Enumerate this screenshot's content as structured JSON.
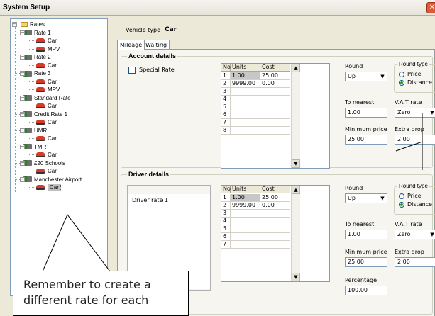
{
  "window": {
    "title": "System Setup",
    "close_glyph": "✕"
  },
  "tree": {
    "root": "Rates",
    "nodes": [
      {
        "label": "Rate 1",
        "kind": "rate"
      },
      {
        "label": "Car",
        "kind": "car"
      },
      {
        "label": "MPV",
        "kind": "car"
      },
      {
        "label": "Rate 2",
        "kind": "rate"
      },
      {
        "label": "Car",
        "kind": "car"
      },
      {
        "label": "Rate 3",
        "kind": "rate"
      },
      {
        "label": "Car",
        "kind": "car"
      },
      {
        "label": "MPV",
        "kind": "car"
      },
      {
        "label": "Standard Rate",
        "kind": "rate"
      },
      {
        "label": "Car",
        "kind": "car"
      },
      {
        "label": "Credit Rate 1",
        "kind": "rate"
      },
      {
        "label": "Car",
        "kind": "car"
      },
      {
        "label": "UMR",
        "kind": "rate"
      },
      {
        "label": "Car",
        "kind": "car"
      },
      {
        "label": "TMR",
        "kind": "rate"
      },
      {
        "label": "Car",
        "kind": "car"
      },
      {
        "label": "£20 Schools",
        "kind": "rate"
      },
      {
        "label": "Car",
        "kind": "car"
      },
      {
        "label": "Manchester Airport",
        "kind": "rate"
      },
      {
        "label": "Car",
        "kind": "car",
        "selected": true
      }
    ]
  },
  "main": {
    "vehicle_type_label": "Vehicle type",
    "vehicle_type_value": "Car",
    "tabs": [
      {
        "label": "Mileage"
      },
      {
        "label": "Waiting"
      }
    ]
  },
  "account": {
    "title": "Account details",
    "special_rate_label": "Special Rate",
    "grid_headers": [
      "No.",
      "Units",
      "Cost"
    ],
    "rows": [
      [
        "1",
        "1.00",
        "25.00"
      ],
      [
        "2",
        "9999.00",
        "0.00"
      ],
      [
        "3",
        "",
        ""
      ],
      [
        "4",
        "",
        ""
      ],
      [
        "5",
        "",
        ""
      ],
      [
        "6",
        "",
        ""
      ],
      [
        "7",
        "",
        ""
      ],
      [
        "8",
        "",
        ""
      ]
    ],
    "round_label": "Round",
    "round_value": "Up",
    "round_type_label": "Round type",
    "round_type_options": [
      "Price",
      "Distance"
    ],
    "round_type_selected": "Distance",
    "to_nearest_label": "To nearest",
    "to_nearest_value": "1.00",
    "vat_label": "V.A.T rate",
    "vat_value": "Zero",
    "min_price_label": "Minimum price",
    "min_price_value": "25.00",
    "extra_drop_label": "Extra drop",
    "extra_drop_value": "2.00"
  },
  "driver": {
    "title": "Driver details",
    "list_items": [
      "Driver rate 1"
    ],
    "grid_headers": [
      "No.",
      "Units",
      "Cost"
    ],
    "rows": [
      [
        "1",
        "1.00",
        "25.00"
      ],
      [
        "2",
        "9999.00",
        "0.00"
      ],
      [
        "3",
        "",
        ""
      ],
      [
        "4",
        "",
        ""
      ],
      [
        "5",
        "",
        ""
      ],
      [
        "6",
        "",
        ""
      ],
      [
        "7",
        "",
        ""
      ]
    ],
    "round_label": "Round",
    "round_value": "Up",
    "round_type_label": "Round type",
    "round_type_options": [
      "Price",
      "Distance"
    ],
    "round_type_selected": "Distance",
    "to_nearest_label": "To nearest",
    "to_nearest_value": "1.00",
    "vat_label": "V.A.T rate",
    "vat_value": "Zero",
    "min_price_label": "Minimum price",
    "min_price_value": "25.00",
    "extra_drop_label": "Extra drop",
    "extra_drop_value": "2.00",
    "percentage_label": "Percentage",
    "percentage_value": "100.00"
  },
  "callout": {
    "text": "Remember to create a different rate for each"
  },
  "colors": {
    "selection": "#c0c0c0",
    "accent": "#21a121",
    "close": "#e05a36"
  }
}
